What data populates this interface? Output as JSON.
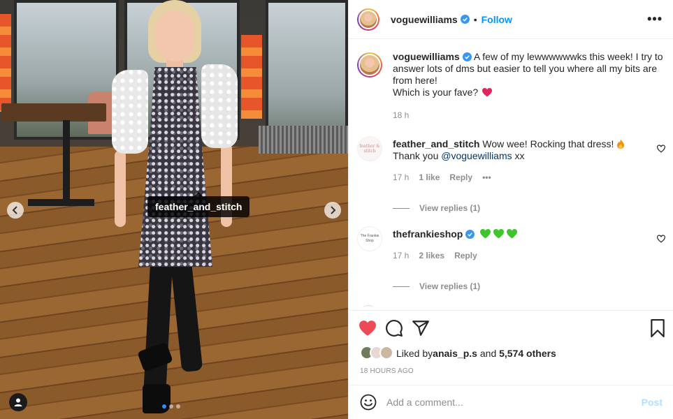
{
  "photo": {
    "tag_label": "feather_and_stitch",
    "carousel_count": 3,
    "carousel_active": 1
  },
  "header": {
    "username": "voguewilliams",
    "separator": "•",
    "follow_label": "Follow",
    "more_label": "•••"
  },
  "caption": {
    "username": "voguewilliams",
    "text": "A few of my lewwwwwwks this week! I try to answer lots of dms but easier to tell you where all my bits are from here!",
    "text2": "Which is your fave?",
    "time": "18 h"
  },
  "comments": [
    {
      "username": "feather_and_stitch",
      "avatar_text": "feather & stitch",
      "text_before": "Wow wee! Rocking that dress! ",
      "text_after": "Thank you ",
      "mention": "@voguewilliams",
      "text_end": " xx",
      "time": "17 h",
      "likes": "1 like",
      "reply": "Reply",
      "options": "•••",
      "view_replies": "View replies (1)"
    },
    {
      "username": "thefrankieshop",
      "avatar_text": "The Frankie Shop",
      "time": "17 h",
      "likes": "2 likes",
      "reply": "Reply",
      "view_replies": "View replies (1)"
    }
  ],
  "likes": {
    "prefix": "Liked by ",
    "first_user": "anais_p.s",
    "mid": " and ",
    "others": "5,574 others"
  },
  "timestamp": "18 HOURS AGO",
  "add_comment": {
    "placeholder": "Add a comment...",
    "post_label": "Post"
  },
  "colors": {
    "accent_blue": "#0095f6",
    "like_red": "#ed4956",
    "heart_emoji_green": "#3cc62a",
    "muted_text": "#8e8e8e"
  }
}
